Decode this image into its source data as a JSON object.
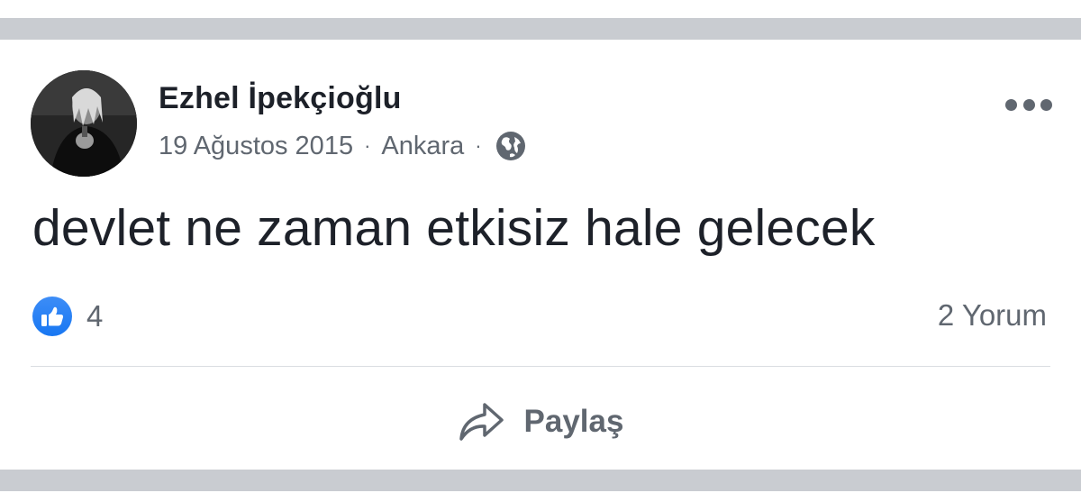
{
  "post": {
    "author": "Ezhel İpekçioğlu",
    "date": "19 Ağustos 2015",
    "separator": "·",
    "location": "Ankara",
    "privacy_icon": "globe-icon",
    "text": "devlet ne zaman etkisiz hale gelecek"
  },
  "reactions": {
    "icon": "like-icon",
    "count": "4",
    "comments": "2 Yorum"
  },
  "actions": {
    "share_label": "Paylaş",
    "share_icon": "share-arrow-icon",
    "more_icon": "more-options-icon"
  },
  "colors": {
    "text_primary": "#1d2129",
    "text_secondary": "#606770",
    "like_blue": "#1877f2",
    "separator_band": "#c9ccd1",
    "divider": "#dadde1"
  }
}
